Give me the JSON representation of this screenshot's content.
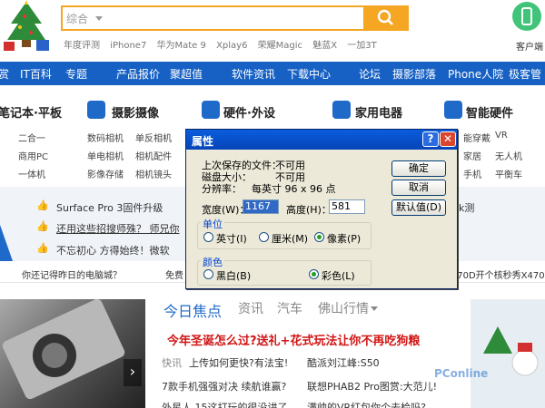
{
  "header": {
    "search": {
      "category": "综合",
      "button_icon": "search-icon"
    },
    "hot_words": [
      "年度评测",
      "iPhone7",
      "华为Mate 9",
      "Xplay6",
      "荣耀Magic",
      "魅蓝X",
      "一加3T"
    ],
    "client_label": "客户端"
  },
  "nav": [
    "赏",
    "IT百科",
    "专题",
    "产品报价",
    "聚超值",
    "软件资讯",
    "下载中心",
    "论坛",
    "摄影部落",
    "Phone人院",
    "极客管"
  ],
  "categories": {
    "c1": {
      "title": "笔记本·平板",
      "items": [
        "二合一",
        "商用PC",
        "一体机"
      ]
    },
    "c2": {
      "title": "摄影摄像",
      "items": [
        "数码相机",
        "单反相机",
        "单电相机",
        "相机配件",
        "影像存储",
        "相机镜头"
      ]
    },
    "c3": {
      "title": "硬件·外设"
    },
    "c4": {
      "title": "家用电器"
    },
    "c5": {
      "title": "智能硬件",
      "items": [
        "能穿戴",
        "VR",
        "家居",
        "无人机",
        "手机",
        "平衡车"
      ]
    }
  },
  "strip": {
    "row1": "Surface Pro 3固件升级",
    "row1_right": "k测",
    "row2": "还用这些招搜师殊？ 师兄你",
    "row3": "不忘初心 方得始终！微软"
  },
  "ticker": [
    "你还记得昨日的电脑城？",
    "免费",
    "X470D开个核秒秀X470"
  ],
  "focus": {
    "tabs": [
      "今日焦点",
      "资讯",
      "汽车",
      "佛山行情"
    ],
    "headline": "今年圣诞怎么过?送礼+花式玩法让你不再吃狗粮",
    "news": [
      {
        "tag": "快讯",
        "text": "上传如何更快?有法宝!"
      },
      {
        "tag": "",
        "text": "酷派刘江峰:S50"
      },
      {
        "tag": "",
        "text": "7款手机强强对决 续航谁赢?"
      },
      {
        "tag": "",
        "text": "联想PHAB2 Pro图赏:大范儿!"
      },
      {
        "tag": "",
        "text": "外星人 15这打玩的很没讲了"
      },
      {
        "tag": "",
        "text": "满帅的VR红包你个去检吗?"
      }
    ],
    "watermark": "PConline"
  },
  "dialog": {
    "title": "属性",
    "last_saved_label": "上次保存的文件：",
    "last_saved_value": "不可用",
    "disk_size_label": "磁盘大小：",
    "disk_size_value": "不可用",
    "resolution_label": "分辨率：",
    "resolution_value": "每英寸 96 x 96 点",
    "width_label": "宽度(W)：",
    "width_value": "1167",
    "height_label": "高度(H)：",
    "height_value": "581",
    "ok": "确定",
    "cancel": "取消",
    "default": "默认值(D)",
    "units_group": "单位",
    "units": [
      "英寸(I)",
      "厘米(M)",
      "像素(P)"
    ],
    "units_selected": "像素(P)",
    "color_group": "颜色",
    "colors": [
      "黑白(B)",
      "彩色(L)"
    ],
    "color_selected": "彩色(L)"
  }
}
